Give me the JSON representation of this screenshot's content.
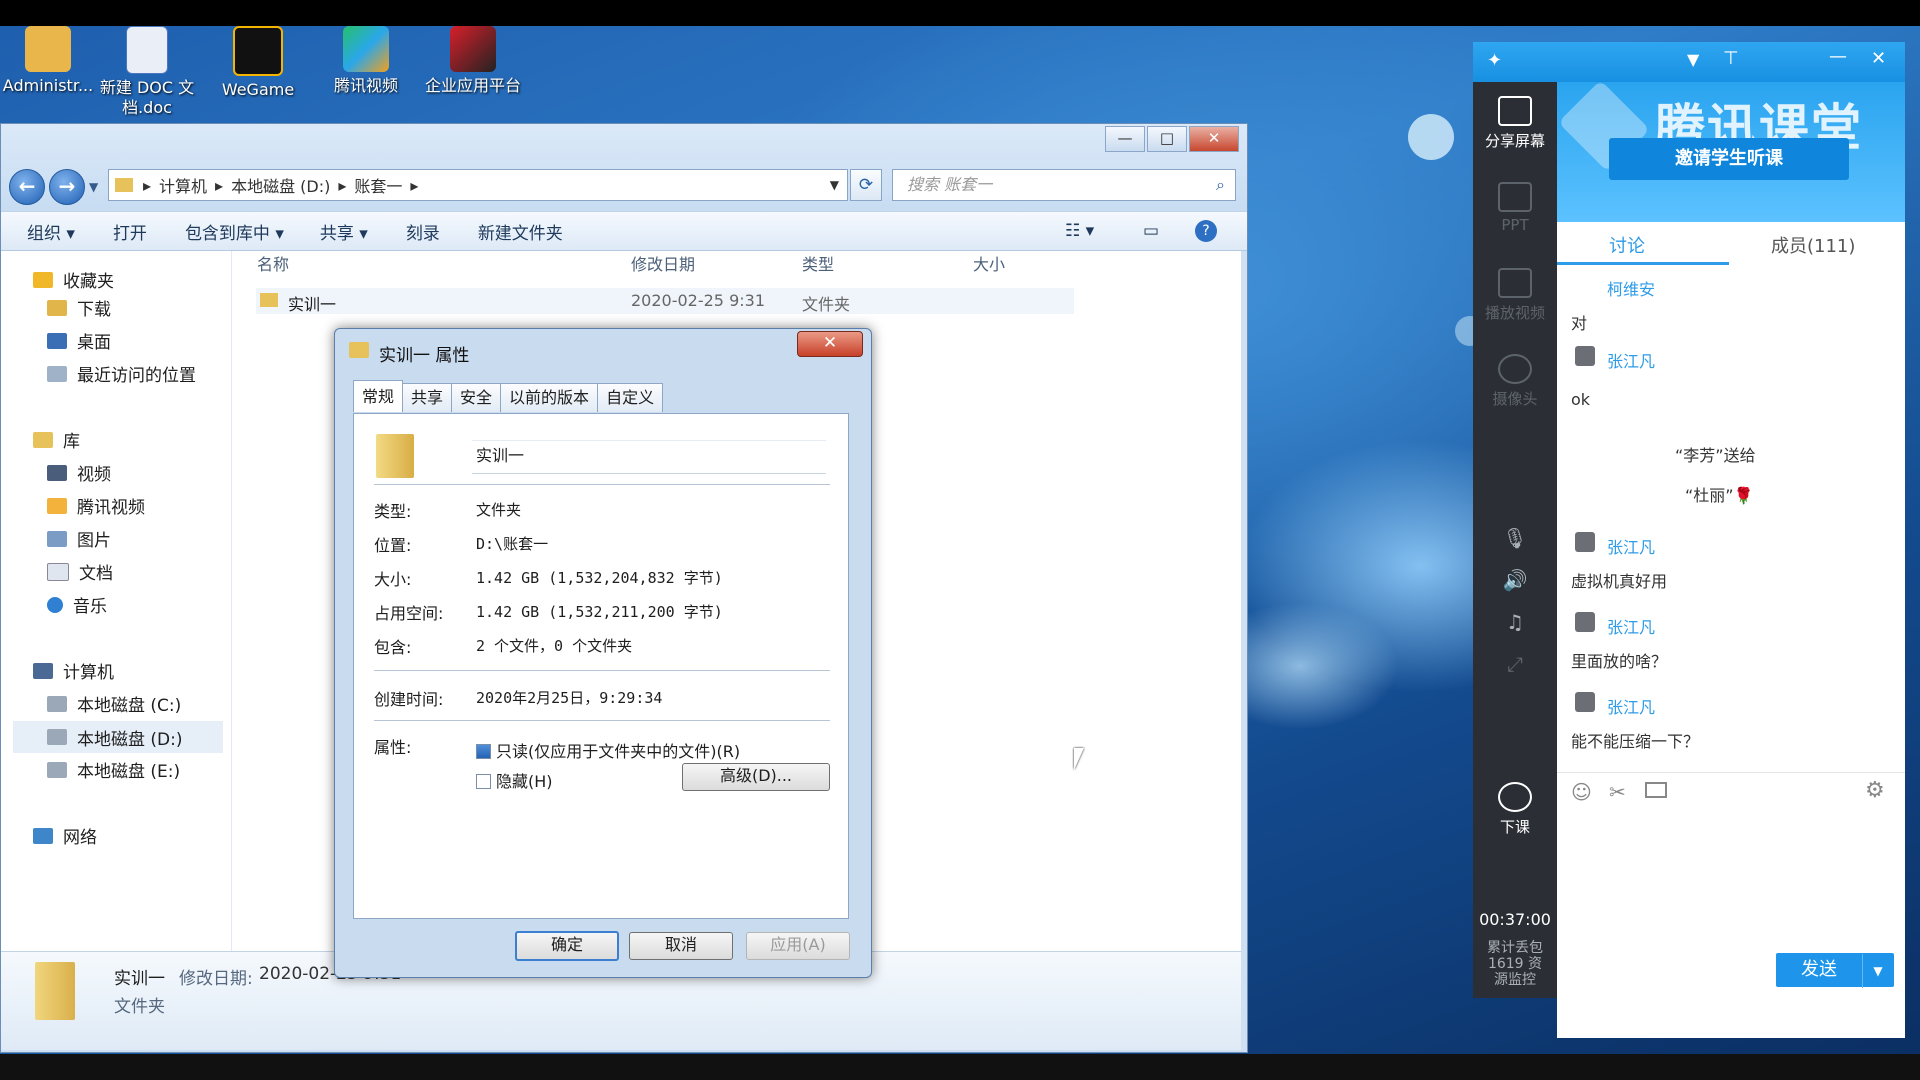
{
  "desktop_icons": [
    {
      "label": "Administr...",
      "color": "#e8b64a"
    },
    {
      "label": "新建 DOC 文档.doc",
      "color": "#e9eef7"
    },
    {
      "label": "WeGame",
      "color": "#111111"
    },
    {
      "label": "腾讯视频",
      "color": "#2aa7ea"
    },
    {
      "label": "企业应用平台",
      "color": "#d81f2a"
    }
  ],
  "explorer": {
    "address_segments": [
      "计算机",
      "本地磁盘 (D:)",
      "账套一"
    ],
    "search_placeholder": "搜索 账套一",
    "toolbar": [
      "组织 ▾",
      "打开",
      "包含到库中 ▾",
      "共享 ▾",
      "刻录",
      "新建文件夹"
    ],
    "nav": {
      "favorites": "收藏夹",
      "favorites_items": [
        "下载",
        "桌面",
        "最近访问的位置"
      ],
      "libraries": "库",
      "libraries_items": [
        "视频",
        "腾讯视频",
        "图片",
        "文档",
        "音乐"
      ],
      "computer": "计算机",
      "computer_items": [
        "本地磁盘 (C:)",
        "本地磁盘 (D:)",
        "本地磁盘 (E:)"
      ],
      "network": "网络"
    },
    "columns": [
      "名称",
      "修改日期",
      "类型",
      "大小"
    ],
    "file": {
      "name": "实训一",
      "modified": "2020-02-25 9:31",
      "type": "文件夹"
    },
    "details": {
      "name": "实训一",
      "modified_label": "修改日期:",
      "modified": "2020-02-25 9:31",
      "type": "文件夹"
    }
  },
  "dialog": {
    "title": "实训一 属性",
    "tabs": [
      "常规",
      "共享",
      "安全",
      "以前的版本",
      "自定义"
    ],
    "folder_name": "实训一",
    "rows": [
      {
        "label": "类型:",
        "value": "文件夹"
      },
      {
        "label": "位置:",
        "value": "D:\\账套一"
      },
      {
        "label": "大小:",
        "value": "1.42 GB (1,532,204,832 字节)"
      },
      {
        "label": "占用空间:",
        "value": "1.42 GB (1,532,211,200 字节)"
      },
      {
        "label": "包含:",
        "value": "2 个文件，0 个文件夹"
      }
    ],
    "created_label": "创建时间:",
    "created": "2020年2月25日，9:29:34",
    "attributes_label": "属性:",
    "readonly": "只读(仅应用于文件夹中的文件)(R)",
    "hidden": "隐藏(H)",
    "advanced": "高级(D)...",
    "ok": "确定",
    "cancel": "取消",
    "apply": "应用(A)"
  },
  "tencent": {
    "brand": "腾讯课堂",
    "invite": "邀请学生听课",
    "side": {
      "share": "分享屏幕",
      "ppt": "PPT",
      "video": "播放视频",
      "camera": "摄像头",
      "end": "下课",
      "timer": "00:37:00",
      "stats": "累计丢包 1619 资源监控"
    },
    "tabs": {
      "discuss": "讨论",
      "members": "成员(111)"
    },
    "chat": [
      {
        "name": "柯维安",
        "msg": "对"
      },
      {
        "name": "张江凡",
        "msg": "ok"
      },
      {
        "gift_line1": "“李芳”送给",
        "gift_line2": "“杜丽”🌹"
      },
      {
        "name": "张江凡",
        "msg": "虚拟机真好用"
      },
      {
        "name": "张江凡",
        "msg": "里面放的啥？"
      },
      {
        "name": "张江凡",
        "msg": "能不能压缩一下？"
      }
    ],
    "send": "发送"
  }
}
